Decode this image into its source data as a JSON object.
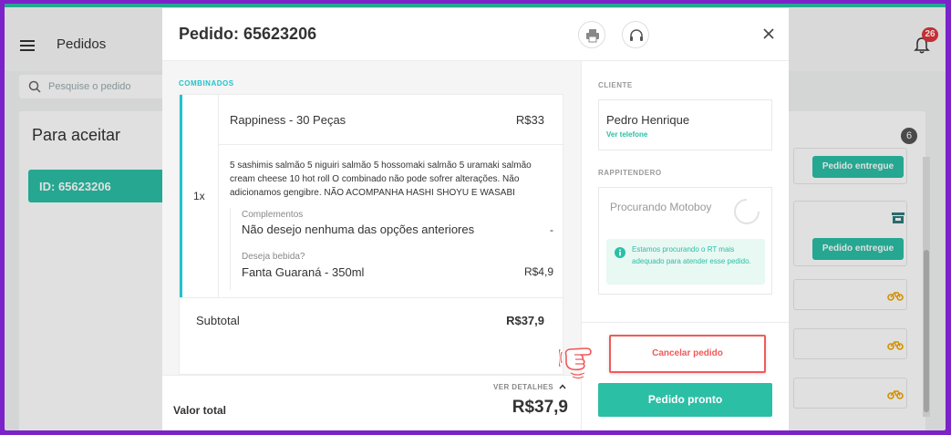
{
  "app": {
    "title": "Pedidos",
    "notifications_count": "26",
    "search_placeholder": "Pesquise o pedido"
  },
  "columns": {
    "to_accept": {
      "title": "Para aceitar",
      "card_label": "ID: 65623206"
    },
    "right": {
      "count": "6",
      "buttons": [
        "Pedido entregue",
        "Pedido entregue"
      ]
    }
  },
  "modal": {
    "title": "Pedido: 65623206",
    "section_label": "COMBINADOS",
    "item": {
      "qty": "1x",
      "name": "Rappiness - 30 Peças",
      "price": "R$33",
      "description": "5 sashimis salmão 5 niguiri salmão 5 hossomaki salmão 5 uramaki salmão cream cheese 10 hot roll O combinado não pode sofrer alterações. Não adicionamos gengibre. NÃO ACOMPANHA HASHI SHOYU E WASABI",
      "options": [
        {
          "label": "Complementos",
          "value": "Não desejo nenhuma das opções anteriores",
          "price": "-"
        },
        {
          "label": "Deseja bebida?",
          "value": "Fanta Guaraná - 350ml",
          "price": "R$4,9"
        }
      ]
    },
    "subtotal_label": "Subtotal",
    "subtotal_value": "R$37,9",
    "details_link": "VER DETALHES",
    "total_label": "Valor total",
    "total_value": "R$37,9",
    "client": {
      "section_label": "CLIENTE",
      "name": "Pedro Henrique",
      "phone_link": "Ver telefone"
    },
    "rappitendero": {
      "section_label": "RAPPITENDERO",
      "status": "Procurando Motoboy",
      "info": "Estamos procurando o RT mais adequado para atender esse pedido."
    },
    "cancel_label": "Cancelar pedido",
    "ready_label": "Pedido pronto"
  },
  "colors": {
    "accent": "#2bbfa6",
    "cyan": "#20c3cc",
    "danger": "#f05a5a",
    "frame": "#7b22c9"
  }
}
